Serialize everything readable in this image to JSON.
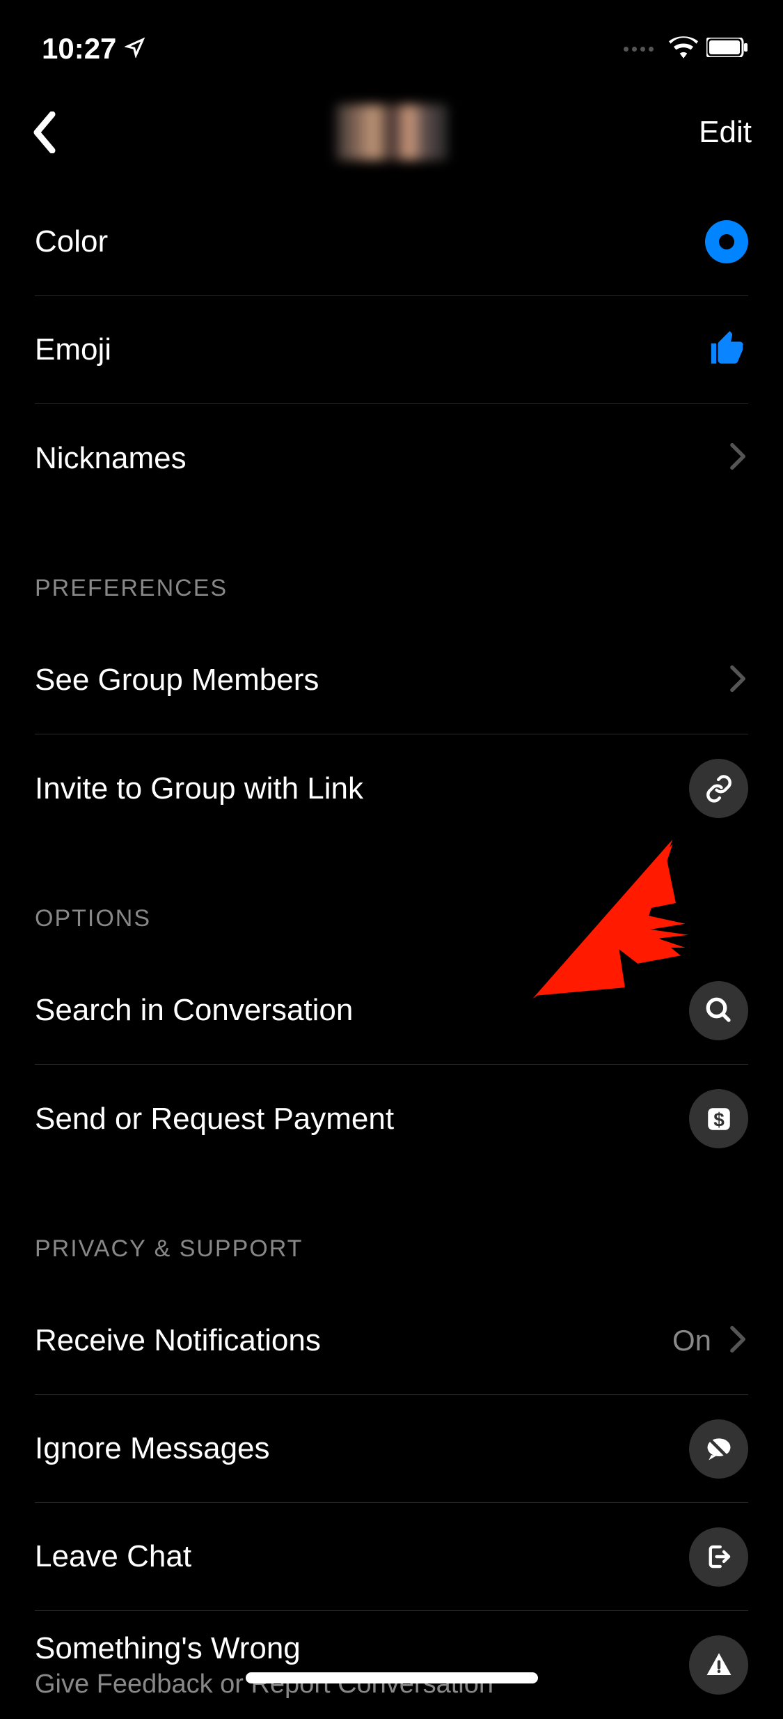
{
  "statusBar": {
    "time": "10:27"
  },
  "header": {
    "editLabel": "Edit"
  },
  "sections": {
    "customization": {
      "color": "Color",
      "emoji": "Emoji",
      "nicknames": "Nicknames"
    },
    "preferences": {
      "header": "PREFERENCES",
      "seeMembers": "See Group Members",
      "inviteLink": "Invite to Group with Link"
    },
    "options": {
      "header": "OPTIONS",
      "search": "Search in Conversation",
      "payment": "Send or Request Payment"
    },
    "privacy": {
      "header": "PRIVACY & SUPPORT",
      "notifications": "Receive Notifications",
      "notificationsValue": "On",
      "ignore": "Ignore Messages",
      "leave": "Leave Chat",
      "wrong": "Something's Wrong",
      "wrongSub": "Give Feedback or Report Conversation"
    }
  },
  "colors": {
    "accent": "#0084ff"
  }
}
